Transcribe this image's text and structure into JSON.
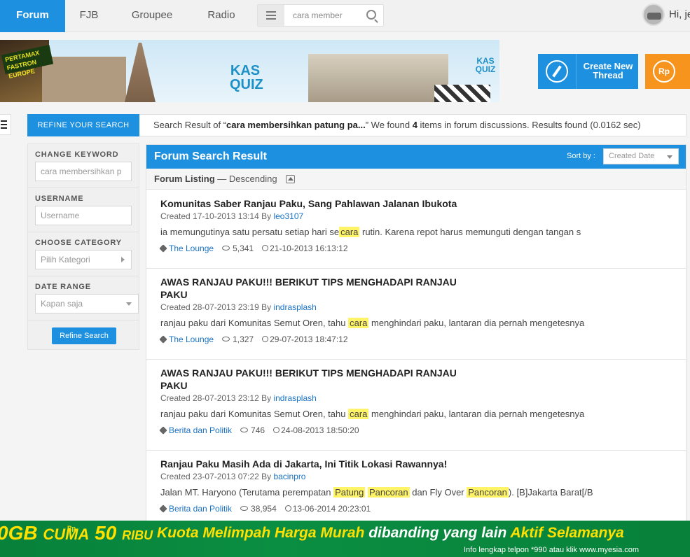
{
  "nav": {
    "tabs": [
      {
        "label": "Forum",
        "active": true
      },
      {
        "label": "FJB",
        "active": false
      },
      {
        "label": "Groupee",
        "active": false
      },
      {
        "label": "Radio",
        "active": false
      }
    ],
    "search_value": "cara member",
    "greeting": "Hi, je"
  },
  "banner": {
    "badge_text": "PERTAMAX FASTRON EUROPE",
    "quiz_label": "KAS QUIZ",
    "quiz_label_2": "KAS QUIZ"
  },
  "actions": {
    "create_thread": "Create New Thread",
    "rp_label": "Rp"
  },
  "refine": {
    "header": "REFINE YOUR SEARCH",
    "keyword_label": "CHANGE KEYWORD",
    "keyword_value": "cara membersihkan p",
    "username_label": "USERNAME",
    "username_placeholder": "Username",
    "category_label": "CHOOSE CATEGORY",
    "category_value": "Pilih Kategori",
    "date_label": "DATE RANGE",
    "date_value": "Kapan saja",
    "button": "Refine Search"
  },
  "summary": {
    "prefix": "Search Result of “",
    "query": "cara membersihkan patung pa...",
    "middle": "” We found ",
    "count": "4",
    "suffix": " items in forum discussions. Results found (0.0162 sec)"
  },
  "result": {
    "title": "Forum Search Result",
    "sort_label": "Sort by :",
    "sort_value": "Created Date",
    "listing_label": "Forum Listing",
    "listing_order": " — Descending",
    "items": [
      {
        "title": "Komunitas Saber Ranjau Paku, Sang Pahlawan Jalanan Ibukota",
        "created": "Created 17-10-2013 13:14 By ",
        "author": "leo3107",
        "snippet_before": "ia memungutinya satu persatu setiap hari se",
        "snippet_hl": "cara",
        "snippet_after": " rutin. Karena repot harus memunguti dengan tangan s",
        "category": "The Lounge",
        "views": "5,341",
        "last": "21-10-2013 16:13:12"
      },
      {
        "title": "AWAS RANJAU PAKU!!! BERIKUT TIPS MENGHADAPI RANJAU PAKU",
        "created": "Created 28-07-2013 23:19 By ",
        "author": "indrasplash",
        "snippet_before": "ranjau paku dari Komunitas Semut Oren, tahu ",
        "snippet_hl": "cara",
        "snippet_after": " menghindari paku, lantaran dia pernah mengetesnya",
        "category": "The Lounge",
        "views": "1,327",
        "last": "29-07-2013 18:47:12"
      },
      {
        "title": "AWAS RANJAU PAKU!!! BERIKUT TIPS MENGHADAPI RANJAU PAKU",
        "created": "Created 28-07-2013 23:12 By ",
        "author": "indrasplash",
        "snippet_before": "ranjau paku dari Komunitas Semut Oren, tahu ",
        "snippet_hl": "cara",
        "snippet_after": " menghindari paku, lantaran dia pernah mengetesnya",
        "category": "Berita dan Politik",
        "views": "746",
        "last": "24-08-2013 18:50:20"
      },
      {
        "title": "Ranjau Paku Masih Ada di Jakarta, Ini Titik Lokasi Rawannya!",
        "created": "Created 23-07-2013 07:22 By ",
        "author": "bacinpro",
        "snippet_p1": "Jalan MT. Haryono (Terutama perempatan ",
        "snippet_hl1": "Patung",
        "snippet_hl2": "Pancoran",
        "snippet_p2": " dan Fly Over ",
        "snippet_hl3": "Pancoran",
        "snippet_p3": "). [B]Jakarta Barat[/B",
        "category": "Berita dan Politik",
        "views": "38,954",
        "last": "13-06-2014 20:23:01"
      }
    ]
  },
  "ad": {
    "size": "0GB",
    "cuma": "CUMA",
    "rp": "Rp",
    "price": "50",
    "ribu": "RIBU",
    "slogan_yellow": "Kuota Melimpah Harga Murah ",
    "slogan_white": "dibanding yang lain",
    "slogan_end": "  Aktif Selamanya",
    "info": "Info lengkap telpon *990 atau klik www.myesia.com"
  }
}
